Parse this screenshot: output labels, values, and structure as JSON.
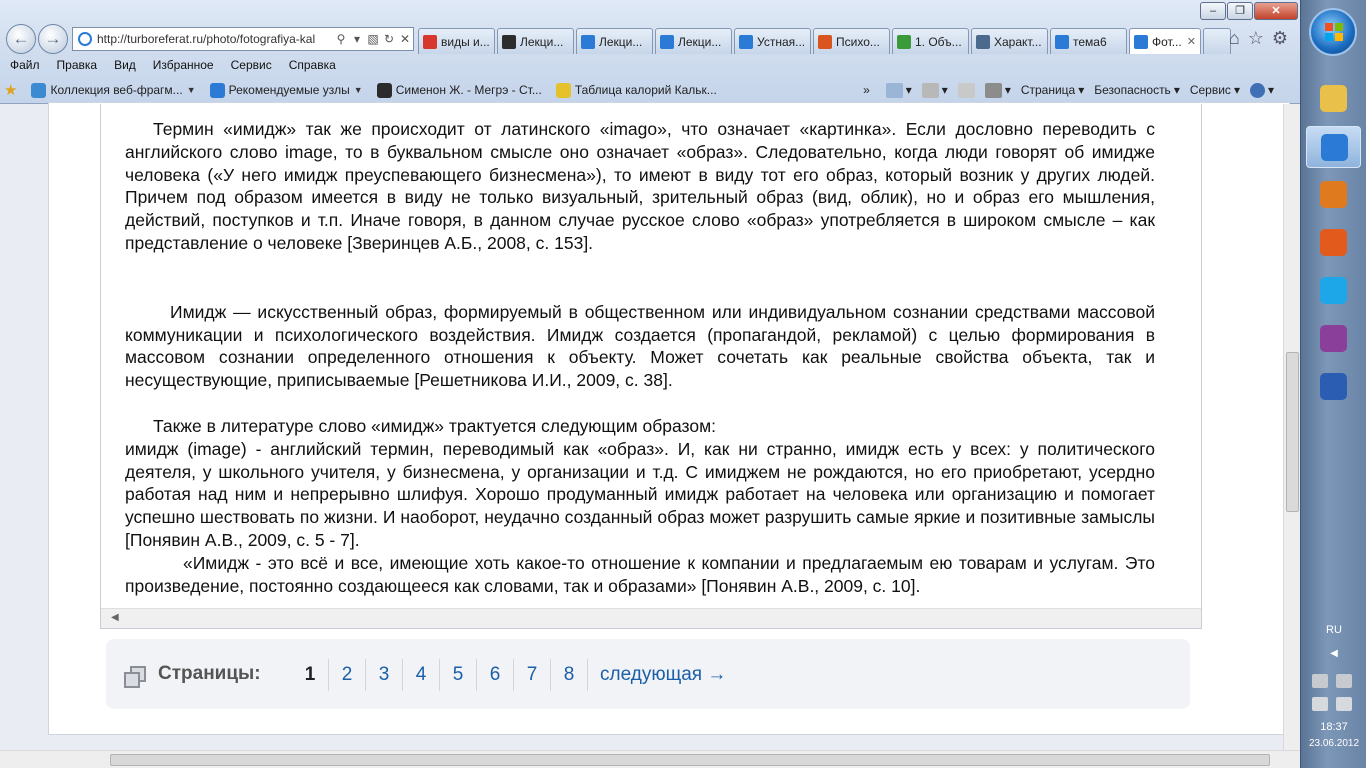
{
  "browser": {
    "url": "http://turboreferat.ru/photo/fotografiya-kal",
    "tabs": [
      {
        "label": "виды и...",
        "color": "#d7372c"
      },
      {
        "label": "Лекци...",
        "color": "#2d2d2d"
      },
      {
        "label": "Лекци...",
        "color": "#2a7ad6"
      },
      {
        "label": "Лекци...",
        "color": "#2a7ad6"
      },
      {
        "label": "Устная...",
        "color": "#2a7ad6"
      },
      {
        "label": "Психо...",
        "color": "#d9541e"
      },
      {
        "label": "1. Объ...",
        "color": "#3a9a3a"
      },
      {
        "label": "Характ...",
        "color": "#4c6a8e"
      },
      {
        "label": "тема6",
        "color": "#2a7ad6"
      },
      {
        "label": "Фот...",
        "color": "#2a7ad6"
      }
    ],
    "menu": [
      "Файл",
      "Правка",
      "Вид",
      "Избранное",
      "Сервис",
      "Справка"
    ],
    "favorites": [
      {
        "label": "Коллекция веб-фрагм...",
        "color": "#3b8bd3"
      },
      {
        "label": "Рекомендуемые узлы",
        "color": "#2a7ad6"
      },
      {
        "label": "Сименон Ж. - Мегрэ - Ст...",
        "color": "#2b2b2b"
      },
      {
        "label": "Таблица калорий  Кальк...",
        "color": "#e5c22b"
      }
    ],
    "commands": [
      "Страница",
      "Безопасность",
      "Сервис"
    ]
  },
  "document": {
    "p1": "Термин  «имидж» так же происходит от латинского «imago», что означает «картинка». Если дословно переводить с английского  слово image, то в буквальном смысле оно означает «образ». Следовательно, когда люди говорят об имидже человека («У него имидж преуспевающего бизнесмена»), то имеют в виду тот его образ, который возник у других людей. Причем под образом имеется в виду не только визуальный, зрительный образ (вид, облик), но и образ его мышления, действий, поступков и т.п. Иначе говоря, в данном случае русское слово «образ» употребляется в широком смысле – как представление о человеке [Зверинцев А.Б., 2008, с. 153].",
    "p2": "Имидж —  искусственный образ, формируемый в общественном или индивидуальном сознании средствами массовой коммуникации и психологического воздействия. Имидж создается (пропагандой, рекламой) с целью формирования в массовом сознании определенного отношения к объекту. Может сочетать как реальные свойства объекта, так и несуществующие, приписываемые [Решетникова И.И., 2009, с. 38].",
    "p3": "Также в литературе слово «имидж» трактуется следующим образом:",
    "p4": "имидж (image) - английский термин, переводимый как «образ». И, как ни странно, имидж есть у всех: у политического деятеля, у школьного учителя, у бизнесмена, у организации и т.д. С имиджем не рождаются, но его приобретают, усердно работая над ним и непрерывно шлифуя. Хорошо продуманный имидж работает на человека или организацию и помогает успешно шествовать по жизни. И наоборот, неудачно созданный образ может разрушить самые яркие и позитивные замыслы [Понявин А.В., 2009, с. 5 - 7].",
    "p5": "«Имидж - это всё и все, имеющие хоть какое-то отношение к компании и предлагаемым ею товарам и услугам. Это произведение, постоянно создающееся как словами, так и образами» [Понявин А.В., 2009, с. 10]."
  },
  "pager": {
    "label": "Страницы:",
    "pages": [
      "1",
      "2",
      "3",
      "4",
      "5",
      "6",
      "7",
      "8"
    ],
    "current": "1",
    "next": "следующая →"
  },
  "taskbar": {
    "apps": [
      {
        "name": "explorer",
        "color": "#e8c04a"
      },
      {
        "name": "internet-explorer",
        "color": "#2a7ad6"
      },
      {
        "name": "media-player",
        "color": "#e07a1f"
      },
      {
        "name": "office",
        "color": "#e25a1c"
      },
      {
        "name": "skype",
        "color": "#1ea7e8"
      },
      {
        "name": "winrar",
        "color": "#8a3f9a"
      },
      {
        "name": "word",
        "color": "#2b5eb3"
      }
    ],
    "language": "RU",
    "time": "18:37",
    "date": "23.06.2012"
  }
}
